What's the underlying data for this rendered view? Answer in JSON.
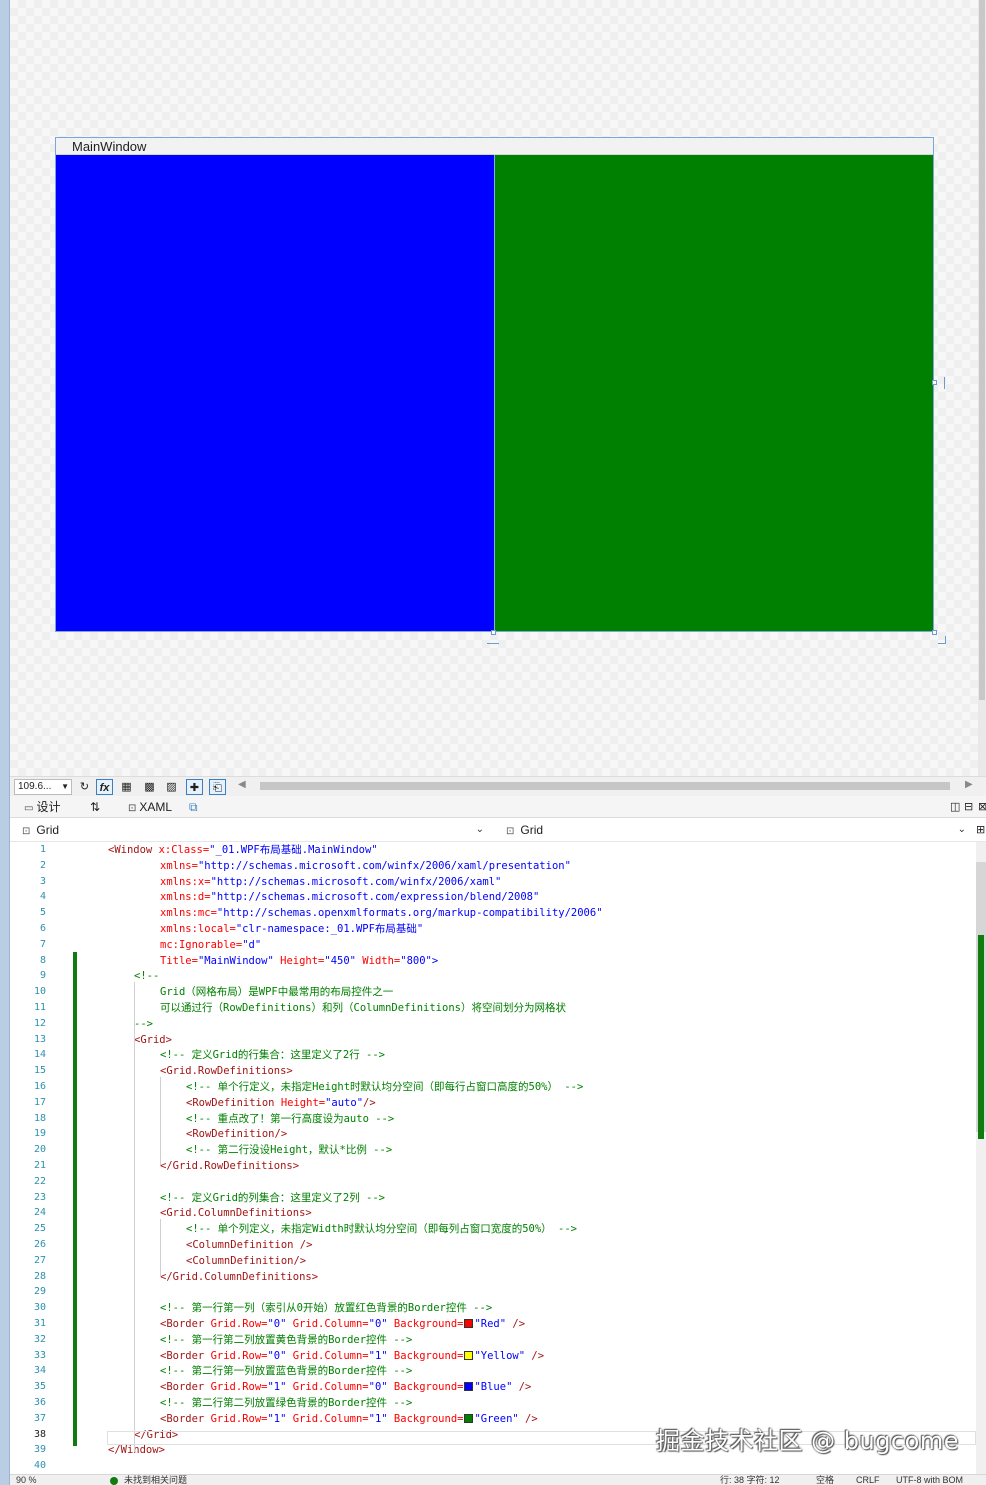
{
  "design": {
    "window_title": "MainWindow",
    "cell_colors": {
      "top_left": "#0000ff",
      "top_right": "#008000"
    }
  },
  "toolbar": {
    "zoom": "109.6...",
    "fx_label": "fx"
  },
  "tabs": {
    "design": "设计",
    "swap": "⇅",
    "xaml": "XAML"
  },
  "selectors": {
    "left": "Grid",
    "right": "Grid"
  },
  "code_lines": [
    "1",
    "2",
    "3",
    "4",
    "5",
    "6",
    "7",
    "8",
    "9",
    "10",
    "11",
    "12",
    "13",
    "14",
    "15",
    "16",
    "17",
    "18",
    "19",
    "20",
    "21",
    "22",
    "23",
    "24",
    "25",
    "26",
    "27",
    "28",
    "29",
    "30",
    "31",
    "32",
    "33",
    "34",
    "35",
    "36",
    "37",
    "38",
    "39",
    "40"
  ],
  "code": {
    "l1_tag": "<Window",
    "l1_attr": " x:Class=",
    "l1_val": "\"_01.WPF布局基础.MainWindow\"",
    "l2_attr": "xmlns=",
    "l2_val": "\"http://schemas.microsoft.com/winfx/2006/xaml/presentation\"",
    "l3_attr": "xmlns:x=",
    "l3_val": "\"http://schemas.microsoft.com/winfx/2006/xaml\"",
    "l4_attr": "xmlns:d=",
    "l4_val": "\"http://schemas.microsoft.com/expression/blend/2008\"",
    "l5_attr": "xmlns:mc=",
    "l5_val": "\"http://schemas.openxmlformats.org/markup-compatibility/2006\"",
    "l6_attr": "xmlns:local=",
    "l6_val": "\"clr-namespace:_01.WPF布局基础\"",
    "l7_attr": "mc:Ignorable=",
    "l7_val": "\"d\"",
    "l8_attr1": "Title=",
    "l8_val1": "\"MainWindow\"",
    "l8_attr2": " Height=",
    "l8_val2": "\"450\"",
    "l8_attr3": " Width=",
    "l8_val3": "\"800\"",
    "l8_end": ">",
    "l9": "<!--",
    "l10": "Grid（网格布局）是WPF中最常用的布局控件之一",
    "l11": "可以通过行（RowDefinitions）和列（ColumnDefinitions）将空间划分为网格状",
    "l12": "-->",
    "l13_tag": "<Grid>",
    "l14": "<!-- 定义Grid的行集合：这里定义了2行 -->",
    "l15_tag": "<Grid.RowDefinitions>",
    "l16": "<!-- 单个行定义，未指定Height时默认均分空间（即每行占窗口高度的50%） -->",
    "l17_tag": "<RowDefinition",
    "l17_attr": " Height=",
    "l17_val": "\"auto\"",
    "l17_end": "/>",
    "l18": "<!-- 重点改了！第一行高度设为auto -->",
    "l19_tag": "<RowDefinition/>",
    "l20": "<!-- 第二行没设Height，默认*比例 -->",
    "l21_tag": "</Grid.RowDefinitions>",
    "l23": "<!-- 定义Grid的列集合：这里定义了2列 -->",
    "l24_tag": "<Grid.ColumnDefinitions>",
    "l25": "<!-- 单个列定义，未指定Width时默认均分空间（即每列占窗口宽度的50%） -->",
    "l26_tag": "<ColumnDefinition />",
    "l27_tag": "<ColumnDefinition/>",
    "l28_tag": "</Grid.ColumnDefinitions>",
    "l30": "<!-- 第一行第一列（索引从0开始）放置红色背景的Border控件 -->",
    "border_tag": "<Border",
    "row_attr": " Grid.Row=",
    "col_attr": " Grid.Column=",
    "bg_attr": " Background=",
    "close_tag": " />",
    "l31_row": "\"0\"",
    "l31_col": "\"0\"",
    "l31_bg": "\"Red\"",
    "l31_swatch": "#ff0000",
    "l32": "<!-- 第一行第二列放置黄色背景的Border控件 -->",
    "l33_row": "\"0\"",
    "l33_col": "\"1\"",
    "l33_bg": "\"Yellow\"",
    "l33_swatch": "#ffff00",
    "l34": "<!-- 第二行第一列放置蓝色背景的Border控件 -->",
    "l35_row": "\"1\"",
    "l35_col": "\"0\"",
    "l35_bg": "\"Blue\"",
    "l35_swatch": "#0000ff",
    "l36": "<!-- 第二行第二列放置绿色背景的Border控件 -->",
    "l37_row": "\"1\"",
    "l37_col": "\"1\"",
    "l37_bg": "\"Green\"",
    "l37_swatch": "#008000",
    "l38_tag": "</Grid>",
    "l39_tag": "</Window>"
  },
  "watermark": "掘金技术社区 @ bugcome",
  "status": {
    "zoom": "90 %",
    "issues": "未找到相关问题",
    "position": "行: 38  字符: 12",
    "spaces": "空格",
    "eol": "CRLF",
    "encoding": "UTF-8 with BOM"
  }
}
